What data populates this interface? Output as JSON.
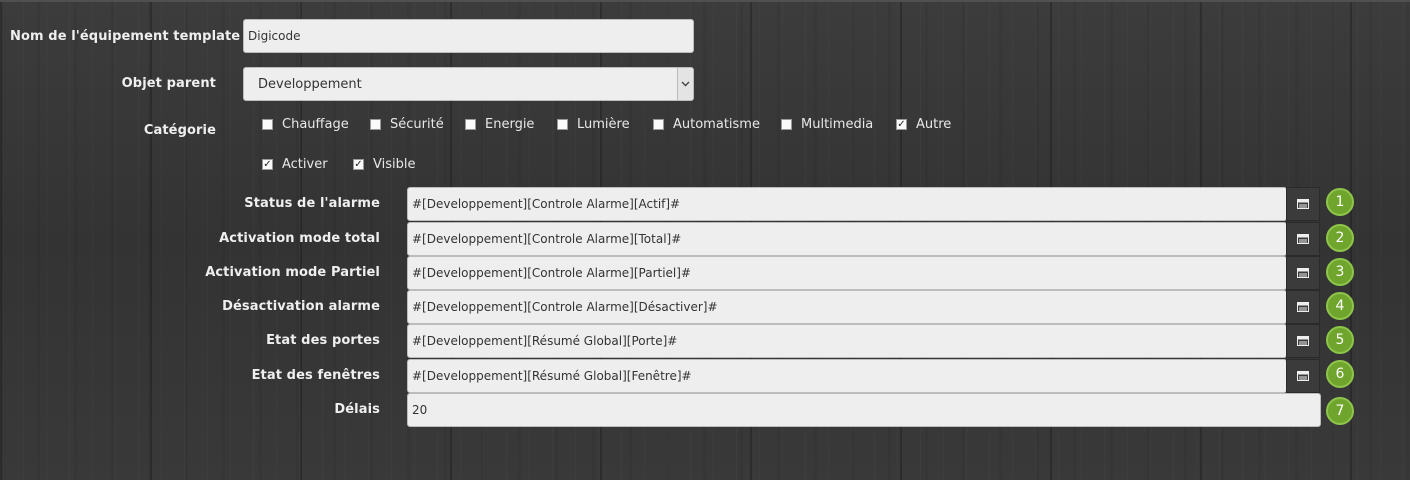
{
  "form": {
    "name_label": "Nom de l'équipement template",
    "name_value": "Digicode",
    "parent_label": "Objet parent",
    "parent_value": "Developpement",
    "category_label": "Catégorie",
    "categories": [
      {
        "label": "Chauffage",
        "checked": false
      },
      {
        "label": "Sécurité",
        "checked": false
      },
      {
        "label": "Energie",
        "checked": false
      },
      {
        "label": "Lumière",
        "checked": false
      },
      {
        "label": "Automatisme",
        "checked": false
      },
      {
        "label": "Multimedia",
        "checked": false
      },
      {
        "label": "Autre",
        "checked": true
      }
    ],
    "options": [
      {
        "label": "Activer",
        "checked": true
      },
      {
        "label": "Visible",
        "checked": true
      }
    ]
  },
  "params": [
    {
      "label": "Status de l'alarme",
      "value": "#[Developpement][Controle Alarme][Actif]#",
      "badge": "1",
      "has_button": true
    },
    {
      "label": "Activation mode total",
      "value": "#[Developpement][Controle Alarme][Total]#",
      "badge": "2",
      "has_button": true
    },
    {
      "label": "Activation mode Partiel",
      "value": "#[Developpement][Controle Alarme][Partiel]#",
      "badge": "3",
      "has_button": true
    },
    {
      "label": "Désactivation alarme",
      "value": "#[Developpement][Controle Alarme][Désactiver]#",
      "badge": "4",
      "has_button": true
    },
    {
      "label": "Etat des portes",
      "value": "#[Developpement][Résumé Global][Porte]#",
      "badge": "5",
      "has_button": true
    },
    {
      "label": "Etat des fenêtres",
      "value": "#[Developpement][Résumé Global][Fenêtre]#",
      "badge": "6",
      "has_button": true
    },
    {
      "label": "Délais",
      "value": "20",
      "badge": "7",
      "has_button": false
    }
  ],
  "colors": {
    "badge": "#6fa52c",
    "background": "#383838"
  },
  "icons": {
    "select_command": "list-icon",
    "dropdown": "chevron-down-icon"
  }
}
